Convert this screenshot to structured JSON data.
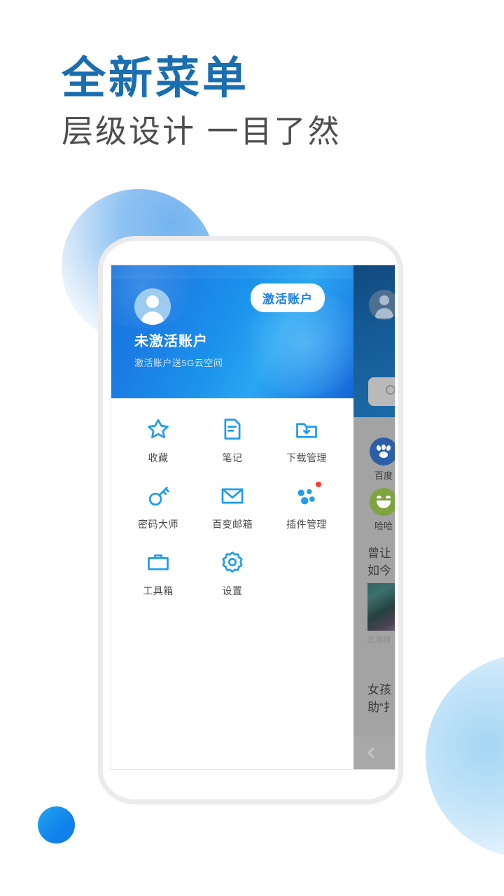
{
  "promo": {
    "headline": "全新菜单",
    "subheadline": "层级设计 一目了然",
    "headline_color": "#1a6eb0",
    "subheadline_color": "#4d4d4d"
  },
  "menu_panel": {
    "header": {
      "account_name": "未激活账户",
      "account_subtitle": "激活账户送5G云空间",
      "activate_label": "激活账户",
      "avatar_icon": "user-avatar-icon",
      "accent": "#1b82e8",
      "gradient_from": "#1473dd",
      "gradient_to": "#2aa6f2"
    },
    "grid": [
      {
        "label": "收藏",
        "icon": "star-icon",
        "badge": false
      },
      {
        "label": "笔记",
        "icon": "note-icon",
        "badge": false
      },
      {
        "label": "下载管理",
        "icon": "download-folder-icon",
        "badge": false
      },
      {
        "label": "密码大师",
        "icon": "key-icon",
        "badge": false
      },
      {
        "label": "百变邮箱",
        "icon": "envelope-icon",
        "badge": false
      },
      {
        "label": "插件管理",
        "icon": "plugin-icon",
        "badge": true
      },
      {
        "label": "工具箱",
        "icon": "toolbox-icon",
        "badge": false
      },
      {
        "label": "设置",
        "icon": "gear-icon",
        "badge": false
      }
    ],
    "icon_color": "#1f9cf0"
  },
  "background_layer": {
    "avatar_icon": "user-avatar-icon",
    "search": {
      "placeholder": "",
      "icon": "search-icon"
    },
    "shortcuts": [
      {
        "label": "百度",
        "icon": "baidu-paw-icon",
        "color": "#2c5fa8"
      },
      {
        "label": "哈哈",
        "icon": "smiley-icon",
        "color": "#7fa340"
      }
    ],
    "news": [
      {
        "lines": [
          "曾让",
          "如今"
        ],
        "source": "北青网",
        "has_thumbnail": true
      },
      {
        "lines": [
          "女孩",
          "助“扌"
        ],
        "source": "",
        "has_thumbnail": false
      }
    ],
    "bottom_bar": {
      "back_icon": "chevron-left-icon"
    },
    "dim_color": "#a3a3a3"
  },
  "decor": {
    "top_blob_color": "#8ec2f2",
    "bottom_right_blob_color": "#bfe2f8",
    "dot_color": "#1183ec"
  }
}
